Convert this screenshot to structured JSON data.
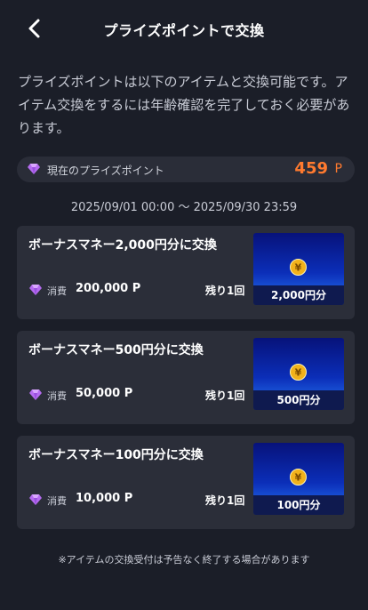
{
  "header": {
    "title": "プライズポイントで交換"
  },
  "description": "プライズポイントは以下のアイテムと交換可能です。アイテム交換をするには年齢確認を完了しておく必要があります。",
  "points": {
    "label": "現在のプライズポイント",
    "value": "459",
    "unit": "P"
  },
  "period": "2025/09/01 00:00 ～ 2025/09/30 23:59",
  "items": [
    {
      "title": "ボーナスマネー2,000円分に交換",
      "cost_label": "消費",
      "cost": "200,000 P",
      "remaining": "残り1回",
      "thumb_label": "2,000円分"
    },
    {
      "title": "ボーナスマネー500円分に交換",
      "cost_label": "消費",
      "cost": "50,000 P",
      "remaining": "残り1回",
      "thumb_label": "500円分"
    },
    {
      "title": "ボーナスマネー100円分に交換",
      "cost_label": "消費",
      "cost": "10,000 P",
      "remaining": "残り1回",
      "thumb_label": "100円分"
    }
  ],
  "footnote": "※アイテムの交換受付は予告なく終了する場合があります",
  "icons": {
    "back": "chevron-left-icon",
    "gem": "gem-icon",
    "coin": "yen-coin-icon"
  },
  "colors": {
    "background": "#1b1e28",
    "card": "#2b2e39",
    "points_accent": "#ff7a2f",
    "gem": "#b56cf0",
    "coin": "#f2b21b"
  }
}
